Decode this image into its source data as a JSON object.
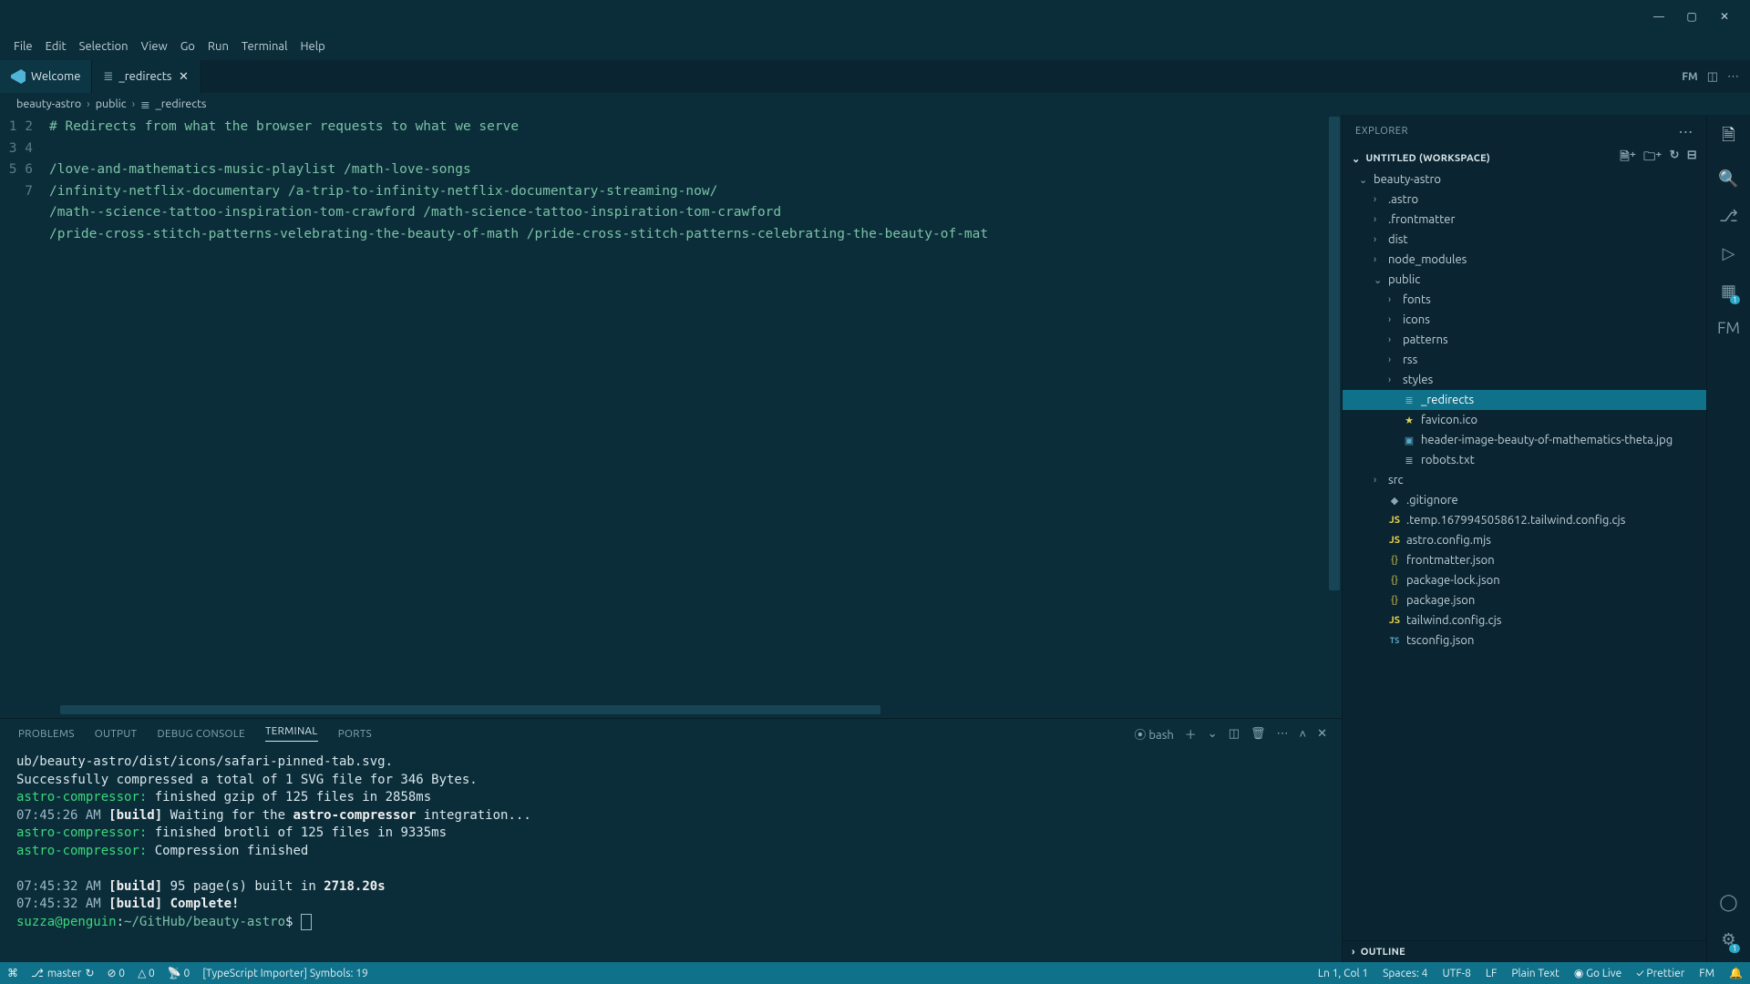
{
  "window": {
    "minimize": "—",
    "maximize": "▢",
    "close": "✕"
  },
  "menu": {
    "items": [
      "File",
      "Edit",
      "Selection",
      "View",
      "Go",
      "Run",
      "Terminal",
      "Help"
    ]
  },
  "tabs": [
    {
      "label": "Welcome",
      "icon": "vscode"
    },
    {
      "label": "_redirects",
      "icon": "file",
      "active": true
    }
  ],
  "breadcrumb": {
    "segments": [
      "beauty-astro",
      "public",
      "_redirects"
    ]
  },
  "editor": {
    "lines": [
      "# Redirects from what the browser requests to what we serve",
      "",
      "/love-and-mathematics-music-playlist /math-love-songs",
      "/infinity-netflix-documentary /a-trip-to-infinity-netflix-documentary-streaming-now/",
      "/math--science-tattoo-inspiration-tom-crawford /math-science-tattoo-inspiration-tom-crawford",
      "/pride-cross-stitch-patterns-velebrating-the-beauty-of-math /pride-cross-stitch-patterns-celebrating-the-beauty-of-mat",
      ""
    ]
  },
  "panel": {
    "tabs": [
      "PROBLEMS",
      "OUTPUT",
      "DEBUG CONSOLE",
      "TERMINAL",
      "PORTS"
    ],
    "active": "TERMINAL",
    "shell": "bash",
    "output": [
      {
        "t": "plain",
        "text": "ub/beauty-astro/dist/icons/safari-pinned-tab.svg."
      },
      {
        "t": "plain",
        "text": "Successfully compressed a total of 1 SVG file for 346 Bytes."
      },
      {
        "t": "ac",
        "text": "astro-compressor:",
        "rest": " finished gzip of 125 files in 2858ms"
      },
      {
        "t": "build",
        "time": "07:45:26 AM",
        "label": "[build]",
        "rest": " Waiting for the ",
        "bold": "astro-compressor",
        "tail": " integration..."
      },
      {
        "t": "ac",
        "text": "astro-compressor:",
        "rest": " finished brotli of 125 files in 9335ms"
      },
      {
        "t": "ac",
        "text": "astro-compressor:",
        "rest": " Compression finished"
      },
      {
        "t": "blank"
      },
      {
        "t": "build",
        "time": "07:45:32 AM",
        "label": "[build]",
        "rest": " 95 page(s) built in ",
        "bold": "2718.20s"
      },
      {
        "t": "build",
        "time": "07:45:32 AM",
        "label": "[build]",
        "rest": " ",
        "bold": "Complete!"
      },
      {
        "t": "prompt",
        "user": "suzza@penguin",
        "path": "~/GitHub/beauty-astro",
        "sym": "$"
      }
    ]
  },
  "explorer": {
    "title": "EXPLORER",
    "workspace": "UNTITLED (WORKSPACE)",
    "outline": "OUTLINE",
    "tree": [
      {
        "depth": 0,
        "name": "beauty-astro",
        "kind": "folder",
        "open": true
      },
      {
        "depth": 1,
        "name": ".astro",
        "kind": "folder"
      },
      {
        "depth": 1,
        "name": ".frontmatter",
        "kind": "folder"
      },
      {
        "depth": 1,
        "name": "dist",
        "kind": "folder"
      },
      {
        "depth": 1,
        "name": "node_modules",
        "kind": "folder"
      },
      {
        "depth": 1,
        "name": "public",
        "kind": "folder",
        "open": true
      },
      {
        "depth": 2,
        "name": "fonts",
        "kind": "folder"
      },
      {
        "depth": 2,
        "name": "icons",
        "kind": "folder"
      },
      {
        "depth": 2,
        "name": "patterns",
        "kind": "folder"
      },
      {
        "depth": 2,
        "name": "rss",
        "kind": "folder"
      },
      {
        "depth": 2,
        "name": "styles",
        "kind": "folder"
      },
      {
        "depth": 2,
        "name": "_redirects",
        "kind": "file",
        "selected": true,
        "icon": "file"
      },
      {
        "depth": 2,
        "name": "favicon.ico",
        "kind": "file",
        "icon": "star"
      },
      {
        "depth": 2,
        "name": "header-image-beauty-of-mathematics-theta.jpg",
        "kind": "file",
        "icon": "img"
      },
      {
        "depth": 2,
        "name": "robots.txt",
        "kind": "file",
        "icon": "file"
      },
      {
        "depth": 1,
        "name": "src",
        "kind": "folder"
      },
      {
        "depth": 1,
        "name": ".gitignore",
        "kind": "file",
        "icon": "gitignore"
      },
      {
        "depth": 1,
        "name": ".temp.1679945058612.tailwind.config.cjs",
        "kind": "file",
        "icon": "js"
      },
      {
        "depth": 1,
        "name": "astro.config.mjs",
        "kind": "file",
        "icon": "js"
      },
      {
        "depth": 1,
        "name": "frontmatter.json",
        "kind": "file",
        "icon": "json"
      },
      {
        "depth": 1,
        "name": "package-lock.json",
        "kind": "file",
        "icon": "json"
      },
      {
        "depth": 1,
        "name": "package.json",
        "kind": "file",
        "icon": "json"
      },
      {
        "depth": 1,
        "name": "tailwind.config.cjs",
        "kind": "file",
        "icon": "js"
      },
      {
        "depth": 1,
        "name": "tsconfig.json",
        "kind": "file",
        "icon": "ts"
      }
    ]
  },
  "activitybar": {
    "items": [
      {
        "name": "explorer-icon",
        "glyph": "🗎",
        "active": true
      },
      {
        "name": "search-icon",
        "glyph": "🔍"
      },
      {
        "name": "scm-icon",
        "glyph": "⎇"
      },
      {
        "name": "run-icon",
        "glyph": "▷"
      },
      {
        "name": "extensions-icon",
        "glyph": "▦",
        "badge": "1"
      },
      {
        "name": "fm-icon",
        "glyph": "FM"
      }
    ],
    "bottom": [
      {
        "name": "account-icon",
        "glyph": "◯"
      },
      {
        "name": "gear-icon",
        "glyph": "⚙",
        "badge": "1"
      }
    ]
  },
  "status": {
    "left": {
      "remote": "⌘",
      "branch": "master",
      "sync": "↻",
      "errors": "⊘ 0",
      "warnings": "△ 0",
      "ports": "📡 0",
      "importer": "[TypeScript Importer] Symbols: 19"
    },
    "right": {
      "pos": "Ln 1, Col 1",
      "spaces": "Spaces: 4",
      "enc": "UTF-8",
      "eol": "LF",
      "lang": "Plain Text",
      "golive": "◉ Go Live",
      "prettier": "✓ Prettier",
      "fm": "FM",
      "bell": "🔔"
    }
  }
}
